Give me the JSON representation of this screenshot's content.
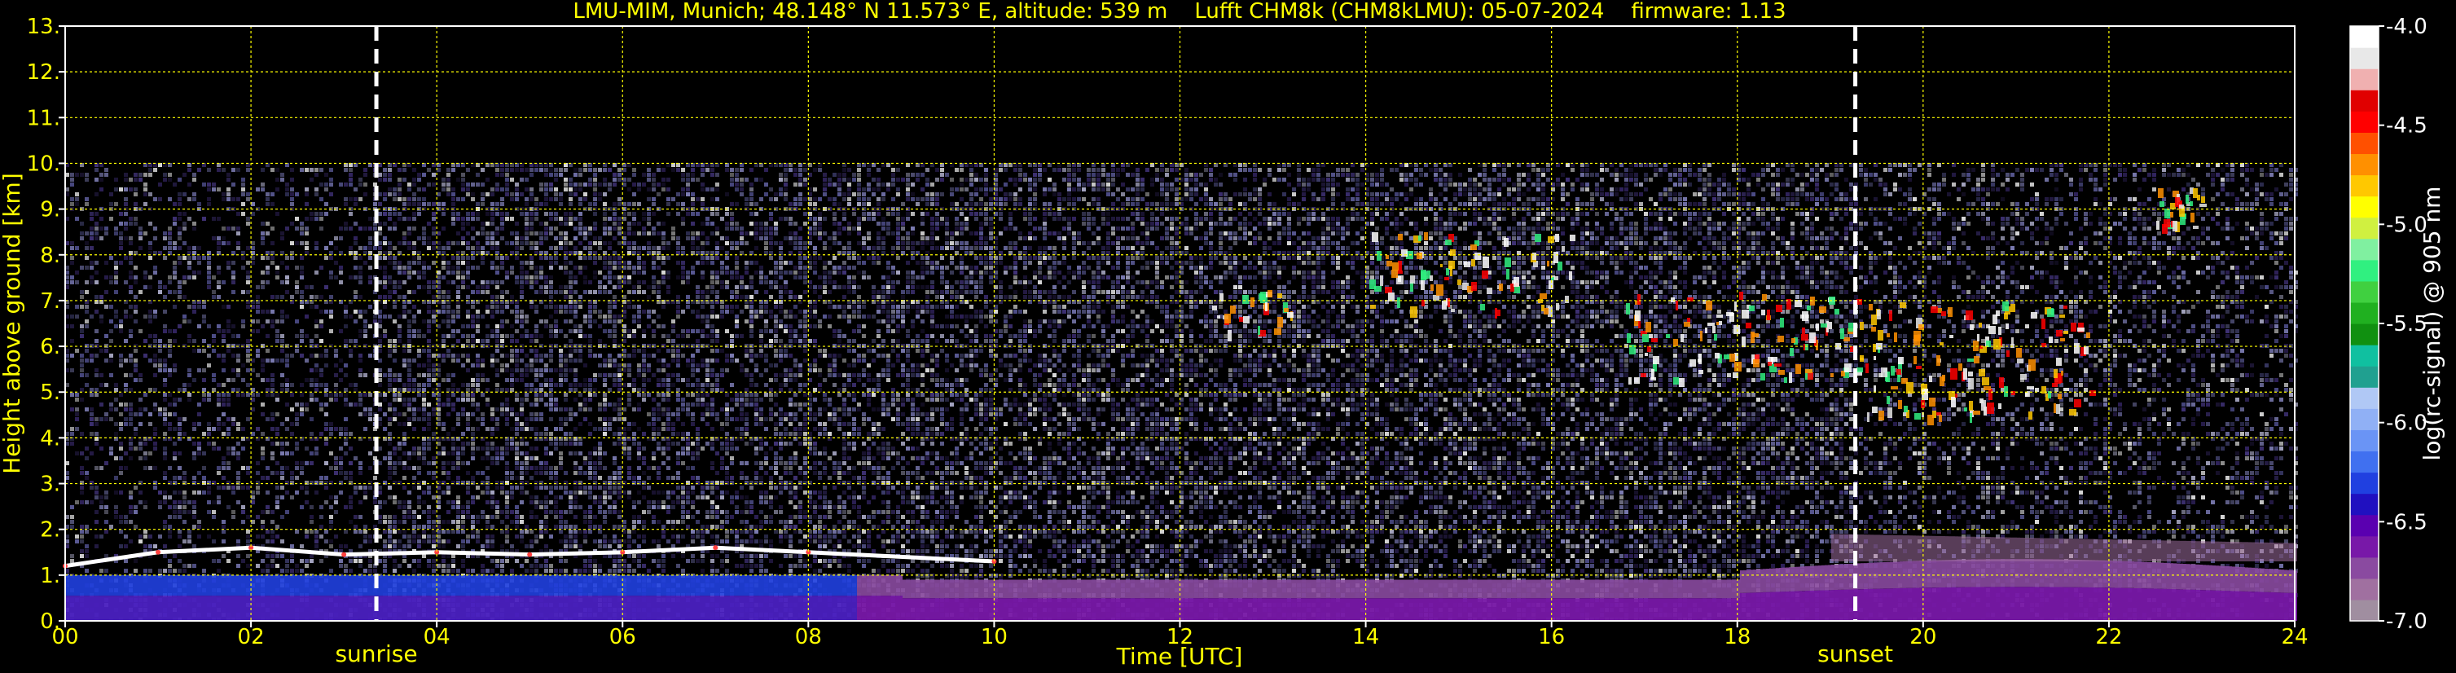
{
  "chart_data": {
    "type": "heatmap",
    "title": "LMU-MIM, Munich; 48.148° N 11.573° E, altitude: 539 m    Lufft CHM8k (CHM8kLMU): 05-07-2024    firmware: 1.13",
    "xlabel": "Time [UTC]",
    "ylabel": "Height above ground [km]",
    "xlim": [
      0,
      24
    ],
    "ylim": [
      0,
      13
    ],
    "x_ticks": [
      "00",
      "02",
      "04",
      "06",
      "08",
      "10",
      "12",
      "14",
      "16",
      "18",
      "20",
      "22",
      "24"
    ],
    "x_tick_values": [
      0,
      2,
      4,
      6,
      8,
      10,
      12,
      14,
      16,
      18,
      20,
      22,
      24
    ],
    "y_ticks": [
      "0.",
      "1.",
      "2.",
      "3.",
      "4.",
      "5.",
      "6.",
      "7.",
      "8.",
      "9.",
      "10.",
      "11.",
      "12.",
      "13."
    ],
    "y_tick_values": [
      0,
      1,
      2,
      3,
      4,
      5,
      6,
      7,
      8,
      9,
      10,
      11,
      12,
      13
    ],
    "grid": true,
    "data_top_km": 10,
    "markers": [
      {
        "label": "sunrise",
        "time": 3.35
      },
      {
        "label": "sunset",
        "time": 19.27
      }
    ],
    "boundary_layer": [
      {
        "t": 0,
        "h": 1.2
      },
      {
        "t": 1,
        "h": 1.5
      },
      {
        "t": 2,
        "h": 1.6
      },
      {
        "t": 3,
        "h": 1.45
      },
      {
        "t": 4,
        "h": 1.5
      },
      {
        "t": 5,
        "h": 1.45
      },
      {
        "t": 6,
        "h": 1.5
      },
      {
        "t": 7,
        "h": 1.6
      },
      {
        "t": 8,
        "h": 1.5
      },
      {
        "t": 10,
        "h": 1.3
      }
    ],
    "clouds": [
      {
        "t0": 12.3,
        "t1": 13.2,
        "h0": 6.3,
        "h1": 7.3
      },
      {
        "t0": 14,
        "t1": 16.2,
        "h0": 6.8,
        "h1": 8.5
      },
      {
        "t0": 16.8,
        "t1": 19.3,
        "h0": 5.3,
        "h1": 7.2
      },
      {
        "t0": 19.3,
        "t1": 21.8,
        "h0": 4.5,
        "h1": 7.0
      },
      {
        "t0": 22.5,
        "t1": 23.0,
        "h0": 8.6,
        "h1": 9.5
      }
    ],
    "colorbar": {
      "label": "log(rc-signal) @ 905 nm",
      "ticks": [
        "-4.0",
        "-4.5",
        "-5.0",
        "-5.5",
        "-6.0",
        "-6.5",
        "-7.0"
      ],
      "tick_values": [
        -4.0,
        -4.5,
        -5.0,
        -5.5,
        -6.0,
        -6.5,
        -7.0
      ],
      "range": [
        -7.0,
        -4.0
      ],
      "colors": [
        "#a08ea0",
        "#a070a0",
        "#8a4aa0",
        "#7818a8",
        "#5a00b0",
        "#2010c0",
        "#2040e0",
        "#4070f0",
        "#6a94f5",
        "#90b0f5",
        "#b0c8f5",
        "#20a090",
        "#10c0a0",
        "#109010",
        "#20b020",
        "#40d040",
        "#30f080",
        "#80f0a0",
        "#d0f040",
        "#ffff00",
        "#ffc800",
        "#ff9000",
        "#ff5000",
        "#ff0000",
        "#e00000",
        "#f0b0b0",
        "#e8e8e8",
        "#ffffff"
      ]
    }
  },
  "colors": {
    "text": "#ffff00",
    "grid": "#ffff00",
    "background": "#000000"
  }
}
